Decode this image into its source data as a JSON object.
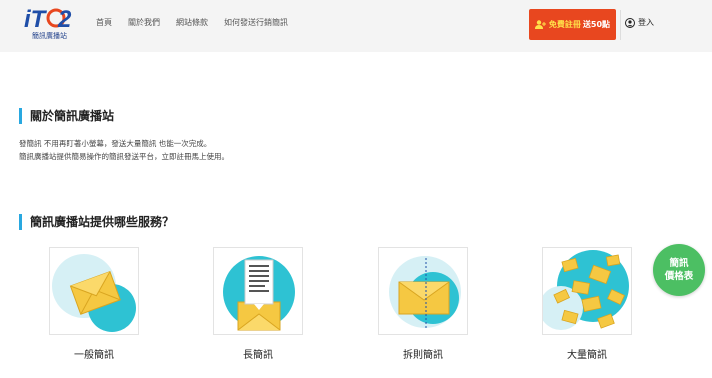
{
  "header": {
    "logo_sub": "簡訊廣播站",
    "nav": [
      "首頁",
      "關於我們",
      "網站條款",
      "如何發送行銷簡訊"
    ],
    "register_yellow": "免費註冊",
    "register_white": "送50點",
    "login": "登入"
  },
  "about": {
    "title": "關於簡訊廣播站",
    "lines": [
      "發簡訊 不用再盯著小螢幕，發送大量簡訊 也能一次完成。",
      "簡訊廣播站提供簡易操作的簡訊發送平台，立即註冊馬上使用。"
    ]
  },
  "services": {
    "title": "簡訊廣播站提供哪些服務？",
    "items": [
      {
        "label": "一般簡訊",
        "icon": "envelope-icon"
      },
      {
        "label": "長簡訊",
        "icon": "long-message-icon"
      },
      {
        "label": "拆則簡訊",
        "icon": "split-envelope-icon"
      },
      {
        "label": "大量簡訊",
        "icon": "bulk-envelopes-icon"
      }
    ]
  },
  "price_badge": {
    "line1": "簡訊",
    "line2": "價格表"
  },
  "colors": {
    "accent": "#29a8e0",
    "register": "#e8471f",
    "badge": "#4cbf63",
    "teal": "#2ec2d3",
    "envelope": "#f5c842"
  }
}
